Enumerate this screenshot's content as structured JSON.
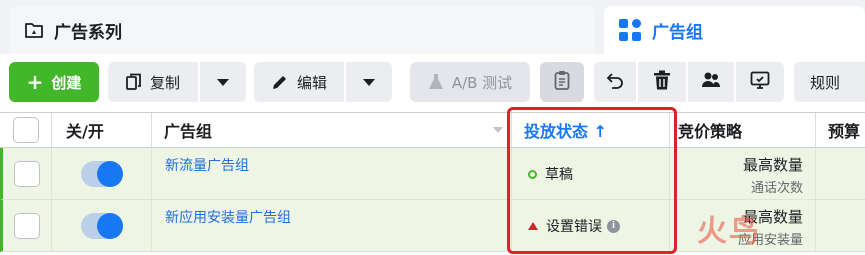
{
  "tabs": [
    {
      "label": "广告系列",
      "icon": "campaign-folder-icon",
      "active": false
    },
    {
      "label": "广告组",
      "icon": "ad-set-grid-icon",
      "active": true
    }
  ],
  "toolbar": {
    "create_label": "创建",
    "copy_label": "复制",
    "edit_label": "编辑",
    "ab_test_label": "A/B 测试",
    "rules_label": "规则"
  },
  "table": {
    "headers": {
      "toggle": "关/开",
      "name": "广告组",
      "status": "投放状态 ↑",
      "bid": "竞价策略",
      "budget": "预算"
    },
    "rows": [
      {
        "name": "新流量广告组",
        "status": "草稿",
        "status_kind": "draft",
        "bid_main": "最高数量",
        "bid_sub": "通话次数",
        "enabled": true
      },
      {
        "name": "新应用安装量广告组",
        "status": "设置错误",
        "status_kind": "error",
        "bid_main": "最高数量",
        "bid_sub": "应用安装量",
        "enabled": true
      }
    ]
  },
  "watermark": "火鸟",
  "colors": {
    "accent": "#1877f2",
    "create_green": "#42b72a",
    "row_bg": "#eef5e5",
    "highlight": "#e0202a",
    "error": "#d8232a"
  }
}
